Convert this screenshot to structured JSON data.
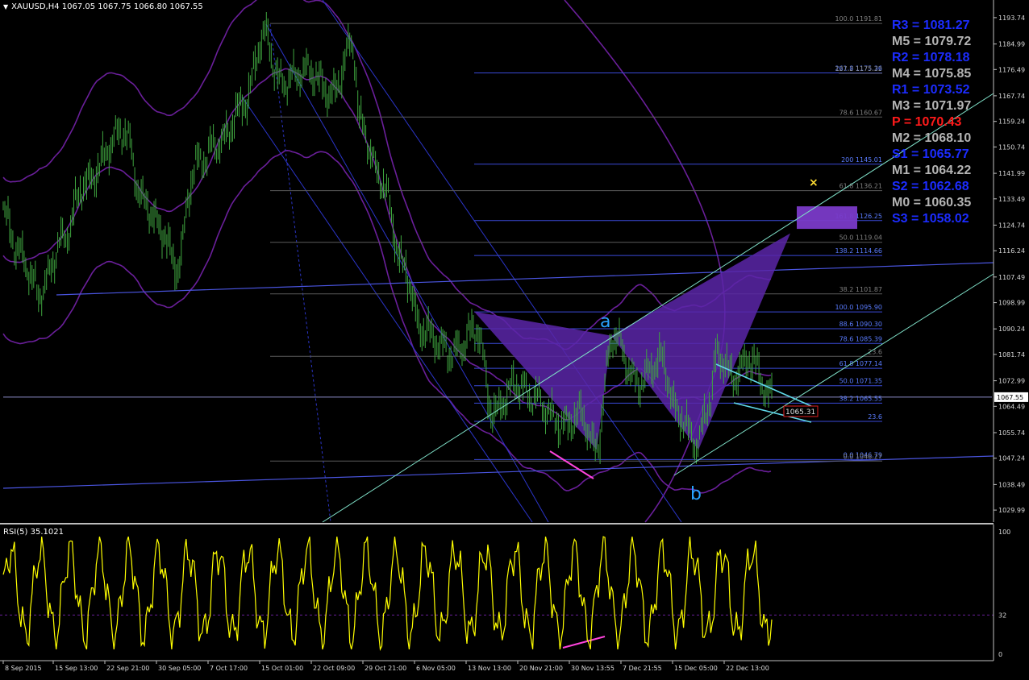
{
  "header": {
    "title": "XAUUSD,H4  1067.05 1067.75 1066.80 1067.55"
  },
  "rsi_panel": {
    "title": "RSI(5) 35.1021",
    "levels": [
      "100",
      "32",
      "0"
    ]
  },
  "current_price": "1067.55",
  "price_tag": "1065.31",
  "price_ticks": [
    "1193.74",
    "1184.99",
    "1176.49",
    "1167.74",
    "1159.24",
    "1150.74",
    "1141.99",
    "1133.49",
    "1124.74",
    "1116.24",
    "1107.49",
    "1098.99",
    "1090.24",
    "1081.74",
    "1072.99",
    "1064.49",
    "1055.74",
    "1047.24",
    "1038.49",
    "1029.99"
  ],
  "time_ticks": [
    "8 Sep 2015",
    "15 Sep 13:00",
    "22 Sep 21:00",
    "30 Sep 05:00",
    "7 Oct 17:00",
    "15 Oct 01:00",
    "22 Oct 09:00",
    "29 Oct 21:00",
    "6 Nov 05:00",
    "13 Nov 13:00",
    "20 Nov 21:00",
    "30 Nov 13:55",
    "7 Dec 21:55",
    "15 Dec 05:00",
    "22 Dec 13:00"
  ],
  "fib_labels": [
    {
      "text": "100.0 1191.81",
      "color": "#808080"
    },
    {
      "text": "261.8 1175.36",
      "color": "#5a7cff"
    },
    {
      "text": "127.2 1175.22",
      "color": "#808080"
    },
    {
      "text": "78.6 1160.67",
      "color": "#808080"
    },
    {
      "text": "200 1145.01",
      "color": "#5a7cff"
    },
    {
      "text": "61.8 1136.21",
      "color": "#808080"
    },
    {
      "text": "161.8 1126.25",
      "color": "#5a7cff"
    },
    {
      "text": "50.0 1119.04",
      "color": "#808080"
    },
    {
      "text": "138.2 1114.66",
      "color": "#5a7cff"
    },
    {
      "text": "38.2 1101.87",
      "color": "#808080"
    },
    {
      "text": "100.0 1095.90",
      "color": "#5a7cff"
    },
    {
      "text": "88.6 1090.30",
      "color": "#5a7cff"
    },
    {
      "text": "78.6 1085.39",
      "color": "#5a7cff"
    },
    {
      "text": "23.6",
      "color": "#808080"
    },
    {
      "text": "61.8 1077.14",
      "color": "#5a7cff"
    },
    {
      "text": "50.0 1071.35",
      "color": "#5a7cff"
    },
    {
      "text": "38.2 1065.55",
      "color": "#5a7cff"
    },
    {
      "text": "23.6",
      "color": "#5a7cff"
    },
    {
      "text": "0.0 1046.79",
      "color": "#5a7cff"
    },
    {
      "text": "0.0 1046.27",
      "color": "#808080"
    }
  ],
  "pattern_labels": {
    "a": "a",
    "b": "b"
  },
  "marker_symbol": "×",
  "pivot_levels": [
    {
      "label": "R3 = 1081.27",
      "color": "#1c2cff"
    },
    {
      "label": "M5 = 1079.72",
      "color": "#b4b4b4"
    },
    {
      "label": "R2 = 1078.18",
      "color": "#1c2cff"
    },
    {
      "label": "M4 = 1075.85",
      "color": "#b4b4b4"
    },
    {
      "label": "R1 = 1073.52",
      "color": "#1c2cff"
    },
    {
      "label": "M3 = 1071.97",
      "color": "#b4b4b4"
    },
    {
      "label": "P   = 1070.43",
      "color": "#ff1a1a"
    },
    {
      "label": "M2 = 1068.10",
      "color": "#b4b4b4"
    },
    {
      "label": "S1 = 1065.77",
      "color": "#1c2cff"
    },
    {
      "label": "M1 = 1064.22",
      "color": "#b4b4b4"
    },
    {
      "label": "S2 = 1062.68",
      "color": "#1c2cff"
    },
    {
      "label": "M0 = 1060.35",
      "color": "#b4b4b4"
    },
    {
      "label": "S3 = 1058.02",
      "color": "#1c2cff"
    }
  ],
  "colors": {
    "background": "#000000",
    "bars": "#3fa53f",
    "axis": "#c0c0c0",
    "pattern_fill": "#5a26a8",
    "envelope": "#6a1f9a",
    "channel": "#2b35c8",
    "trendline": "#7fe0c8",
    "rsi_line": "#ffff00",
    "divergence": "#ff44dd",
    "pattern_label": "#29a3ff"
  },
  "chart_data": [
    {
      "type": "candlestick",
      "symbol": "XAUUSD",
      "timeframe": "H4",
      "ohlc_last": {
        "open": 1067.05,
        "high": 1067.75,
        "low": 1066.8,
        "close": 1067.55
      },
      "ylim": [
        1026.0,
        1198.0
      ],
      "x_categories": [
        "8 Sep 2015",
        "15 Sep 13:00",
        "22 Sep 21:00",
        "30 Sep 05:00",
        "7 Oct 17:00",
        "15 Oct 01:00",
        "22 Oct 09:00",
        "29 Oct 21:00",
        "6 Nov 05:00",
        "13 Nov 13:00",
        "20 Nov 21:00",
        "30 Nov 13:55",
        "7 Dec 21:55",
        "15 Dec 05:00",
        "22 Dec 13:00"
      ],
      "approx_close_path": [
        [
          "8 Sep 2015",
          1125
        ],
        [
          "15 Sep 13:00",
          1110
        ],
        [
          "22 Sep 21:00",
          1135
        ],
        [
          "30 Sep 05:00",
          1112
        ],
        [
          "7 Oct 17:00",
          1150
        ],
        [
          "15 Oct 01:00",
          1185
        ],
        [
          "22 Oct 09:00",
          1170
        ],
        [
          "29 Oct 21:00",
          1145
        ],
        [
          "6 Nov 05:00",
          1100
        ],
        [
          "13 Nov 13:00",
          1085
        ],
        [
          "20 Nov 21:00",
          1065
        ],
        [
          "30 Nov 13:55",
          1050
        ],
        [
          "7 Dec 21:55",
          1075
        ],
        [
          "15 Dec 05:00",
          1052
        ],
        [
          "22 Dec 13:00",
          1072
        ]
      ],
      "fibonacci_levels": [
        {
          "ratio": "100.0",
          "price": 1191.81
        },
        {
          "ratio": "78.6",
          "price": 1160.67
        },
        {
          "ratio": "61.8",
          "price": 1136.21
        },
        {
          "ratio": "50.0",
          "price": 1119.04
        },
        {
          "ratio": "38.2",
          "price": 1101.87
        },
        {
          "ratio": "0.0",
          "price": 1046.27
        },
        {
          "ratio": "261.8",
          "price": 1175.36
        },
        {
          "ratio": "200",
          "price": 1145.01
        },
        {
          "ratio": "161.8",
          "price": 1126.25
        },
        {
          "ratio": "138.2",
          "price": 1114.66
        },
        {
          "ratio": "100.0",
          "price": 1095.9
        },
        {
          "ratio": "88.6",
          "price": 1090.3
        },
        {
          "ratio": "78.6",
          "price": 1085.39
        },
        {
          "ratio": "61.8",
          "price": 1077.14
        },
        {
          "ratio": "50.0",
          "price": 1071.35
        },
        {
          "ratio": "38.2",
          "price": 1065.55
        },
        {
          "ratio": "0.0",
          "price": 1046.79
        }
      ],
      "pivots": {
        "R3": 1081.27,
        "M5": 1079.72,
        "R2": 1078.18,
        "M4": 1075.85,
        "R1": 1073.52,
        "M3": 1071.97,
        "P": 1070.43,
        "M2": 1068.1,
        "S1": 1065.77,
        "M1": 1064.22,
        "S2": 1062.68,
        "M0": 1060.35,
        "S3": 1058.02
      }
    },
    {
      "type": "line",
      "title": "RSI(5) 35.1021",
      "ylim": [
        0,
        100
      ],
      "levels": [
        32
      ],
      "last_value": 35.1021
    }
  ]
}
